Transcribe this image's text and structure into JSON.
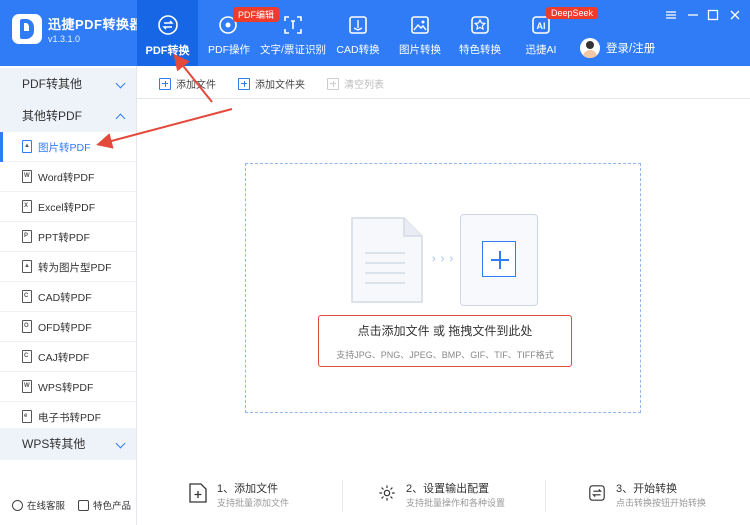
{
  "app": {
    "name": "迅捷PDF转换器",
    "version": "v1.3.1.0"
  },
  "tabs": [
    {
      "label": "PDF转换",
      "icon": "convert-icon",
      "active": true
    },
    {
      "label": "PDF操作",
      "icon": "pdf-operate-icon",
      "badge": "PDF编辑"
    },
    {
      "label": "文字/票证识别",
      "icon": "ocr-scan-icon"
    },
    {
      "label": "CAD转换",
      "icon": "cad-icon"
    },
    {
      "label": "图片转换",
      "icon": "image-icon"
    },
    {
      "label": "特色转换",
      "icon": "star-icon"
    },
    {
      "label": "迅捷AI",
      "icon": "ai-icon",
      "badge": "DeepSeek"
    }
  ],
  "login": {
    "label": "登录/注册"
  },
  "sidebar": {
    "groups": [
      {
        "label": "PDF转其他",
        "expanded": false
      },
      {
        "label": "其他转PDF",
        "expanded": true
      },
      {
        "label": "WPS转其他",
        "expanded": false
      }
    ],
    "items": [
      {
        "label": "图片转PDF",
        "icon": "image-file-icon",
        "active": true
      },
      {
        "label": "Word转PDF",
        "icon": "word-file-icon"
      },
      {
        "label": "Excel转PDF",
        "icon": "excel-file-icon"
      },
      {
        "label": "PPT转PDF",
        "icon": "ppt-file-icon"
      },
      {
        "label": "转为图片型PDF",
        "icon": "image-pdf-icon"
      },
      {
        "label": "CAD转PDF",
        "icon": "cad-file-icon"
      },
      {
        "label": "OFD转PDF",
        "icon": "ofd-file-icon"
      },
      {
        "label": "CAJ转PDF",
        "icon": "caj-file-icon"
      },
      {
        "label": "WPS转PDF",
        "icon": "wps-file-icon"
      },
      {
        "label": "电子书转PDF",
        "icon": "ebook-file-icon"
      }
    ],
    "footer": [
      {
        "label": "在线客服",
        "icon": "support-icon"
      },
      {
        "label": "特色产品",
        "icon": "products-icon"
      }
    ]
  },
  "toolbar": {
    "add_file": "添加文件",
    "add_folder": "添加文件夹",
    "clear_list": "清空列表"
  },
  "dropzone": {
    "main": "点击添加文件 或 拖拽文件到此处",
    "sub": "支持JPG、PNG、JPEG、BMP、GIF、TIF、TIFF格式",
    "arrows": "› › ›"
  },
  "steps": [
    {
      "title": "1、添加文件",
      "sub": "支持批量添加文件",
      "icon": "add-file-step-icon"
    },
    {
      "title": "2、设置输出配置",
      "sub": "支持批量操作和各种设置",
      "icon": "settings-step-icon"
    },
    {
      "title": "3、开始转换",
      "sub": "点击转换按钮开始转换",
      "icon": "convert-step-icon"
    }
  ],
  "colors": {
    "brand": "#2f7cf6",
    "active_tab": "#1766e6",
    "badge": "#ee3b2a",
    "annotation": "#e34a3c"
  }
}
